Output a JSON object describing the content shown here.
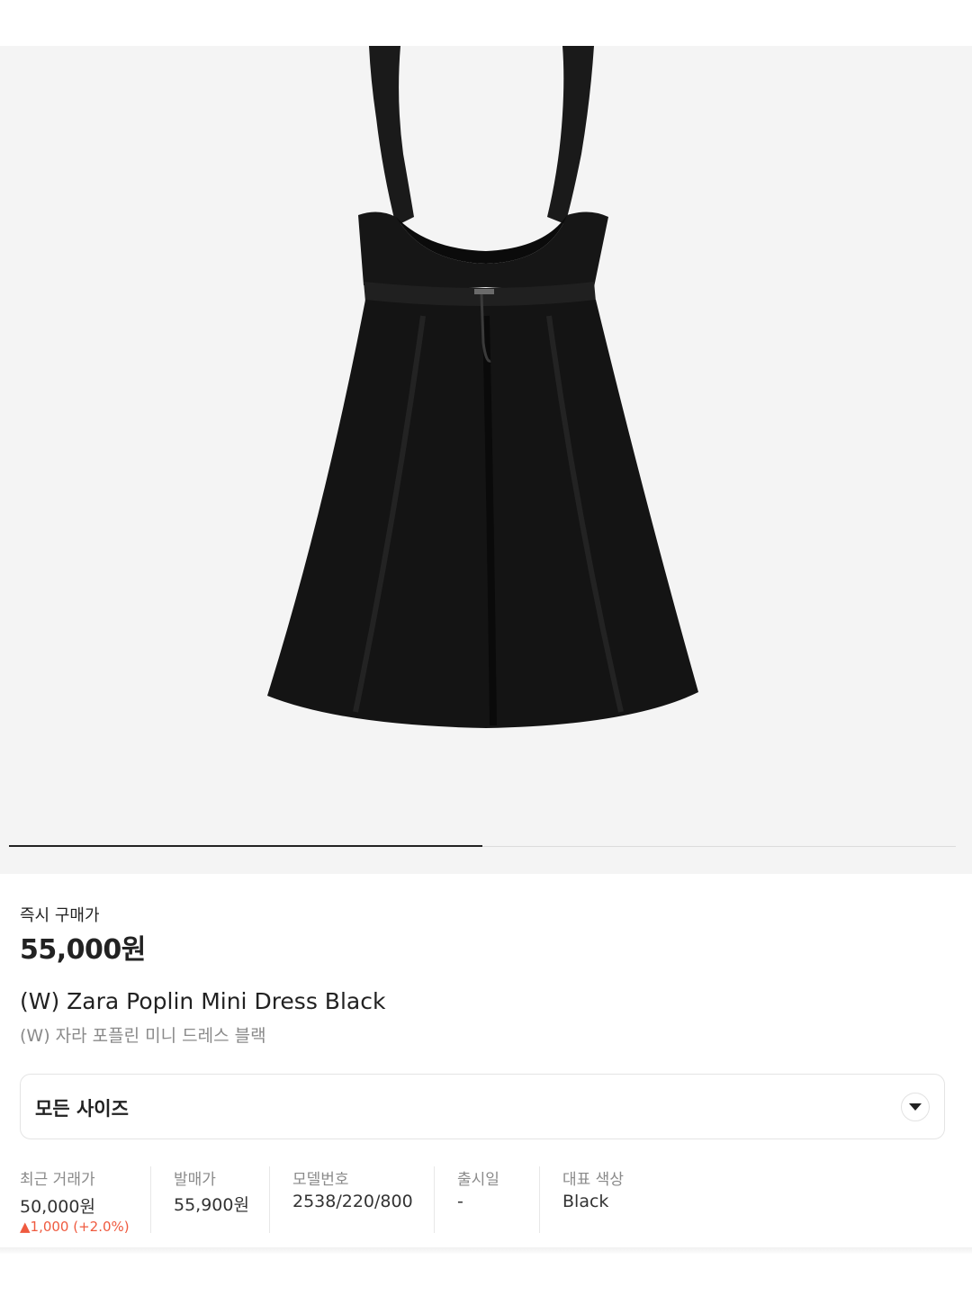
{
  "product": {
    "image_alt": "black poplin mini dress product photo",
    "image_index": 1,
    "image_count": 2
  },
  "instant_buy": {
    "label": "즉시 구매가",
    "price": "55,000원"
  },
  "title": {
    "en": "(W) Zara Poplin Mini Dress Black",
    "ko": "(W) 자라 포플린 미니 드레스 블랙"
  },
  "size_selector": {
    "label": "모든 사이즈",
    "icon": "chevron-down-icon"
  },
  "info": {
    "recent_trade": {
      "label": "최근 거래가",
      "value": "50,000원",
      "change": "▲1,000 (+2.0%)"
    },
    "release_price": {
      "label": "발매가",
      "value": "55,900원"
    },
    "model_number": {
      "label": "모델번호",
      "value": "2538/220/800"
    },
    "release_date": {
      "label": "출시일",
      "value": "-"
    },
    "color": {
      "label": "대표 색상",
      "value": "Black"
    }
  },
  "colors": {
    "accent_up": "#ef5a3f",
    "text_primary": "#222222",
    "text_secondary": "#8a8a8a"
  }
}
